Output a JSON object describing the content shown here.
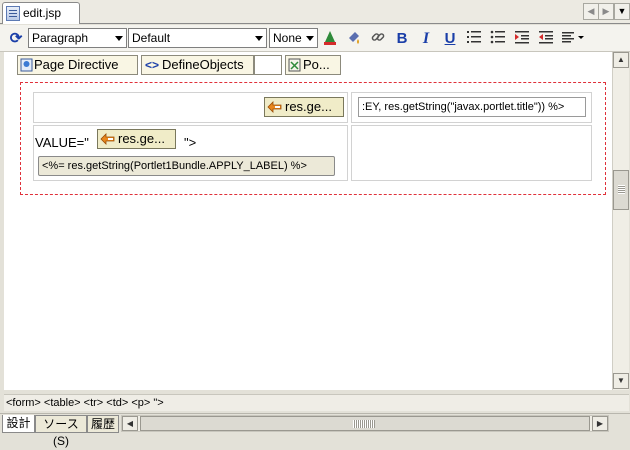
{
  "editor_tab": {
    "label": "edit.jsp",
    "icon": "jsp-file-icon"
  },
  "toolbar": {
    "paragraph_select": "Paragraph",
    "font_select": "Default",
    "size_select": "None",
    "icons": [
      "text-color-icon",
      "highlight-icon",
      "link-icon",
      "bold-icon",
      "italic-icon",
      "underline-icon",
      "ordered-list-icon",
      "unordered-list-icon",
      "indent-icon",
      "outdent-icon",
      "align-icon"
    ],
    "bold_glyph": "B",
    "italic_glyph": "I",
    "underline_glyph": "U"
  },
  "design": {
    "directive_label": "Page Directive",
    "define_objects_label": "DefineObjects",
    "portlet_label": "Po...",
    "row1_chip": "res.ge...",
    "row1_text": ":EY, res.getString(\"javax.portlet.title\")) %>",
    "value_prefix": "VALUE=\"",
    "value_chip": "res.ge...",
    "value_suffix": "\">",
    "button_text": "<%= res.getString(Portlet1Bundle.APPLY_LABEL) %>"
  },
  "tag_path": [
    "<form>",
    "<table>",
    "<tr>",
    "<td>",
    "<p>",
    "\">"
  ],
  "tag_path_text": "<form> <table> <tr> <td> <p> \">",
  "bottom_tabs": [
    "設計",
    "ソース(S)",
    "履歴"
  ],
  "colors": {
    "dashed_border": "#e0303a",
    "accent_blue": "#1a3ea8",
    "chip_bg": "#f0ecc8"
  }
}
